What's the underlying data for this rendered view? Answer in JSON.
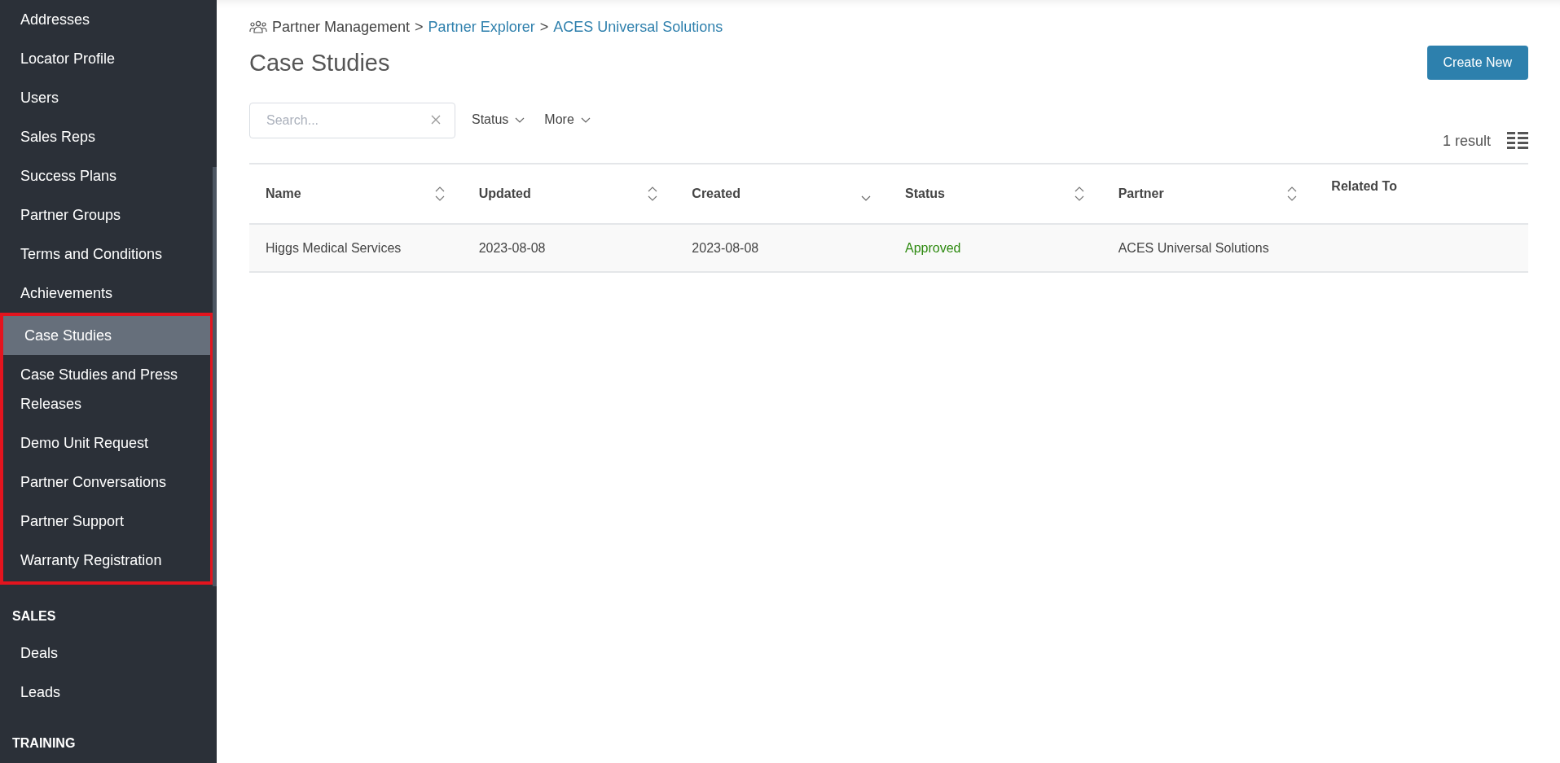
{
  "sidebar": {
    "items": [
      {
        "label": "Addresses",
        "selected": false
      },
      {
        "label": "Locator Profile",
        "selected": false
      },
      {
        "label": "Users",
        "selected": false
      },
      {
        "label": "Sales Reps",
        "selected": false
      },
      {
        "label": "Success Plans",
        "selected": false
      },
      {
        "label": "Partner Groups",
        "selected": false
      },
      {
        "label": "Terms and Conditions",
        "selected": false
      },
      {
        "label": "Achievements",
        "selected": false
      }
    ],
    "highlighted_items": [
      {
        "label": "Case Studies",
        "selected": true
      },
      {
        "label": "Case Studies and Press Releases",
        "selected": false
      },
      {
        "label": "Demo Unit Request",
        "selected": false
      },
      {
        "label": "Partner Conversations",
        "selected": false
      },
      {
        "label": "Partner Support",
        "selected": false
      },
      {
        "label": "Warranty Registration",
        "selected": false
      }
    ],
    "sections": [
      {
        "heading": "SALES",
        "items": [
          {
            "label": "Deals",
            "selected": false
          },
          {
            "label": "Leads",
            "selected": false
          }
        ]
      },
      {
        "heading": "TRAINING"
      }
    ]
  },
  "breadcrumb": [
    {
      "label": "Partner Management",
      "kind": "root"
    },
    {
      "separator": ">",
      "label": "Partner Explorer",
      "kind": "link"
    },
    {
      "separator": ">",
      "label": "ACES Universal Solutions",
      "kind": "link"
    }
  ],
  "page_title": "Case Studies",
  "create_button": "Create New",
  "search": {
    "placeholder": "Search..."
  },
  "filters": [
    "Status",
    "More"
  ],
  "result_count": "1 result",
  "table": {
    "columns": [
      {
        "label": "Name",
        "sortable": true,
        "sorted_desc": false
      },
      {
        "label": "Updated",
        "sortable": true,
        "sorted_desc": false
      },
      {
        "label": "Created",
        "sortable": true,
        "sorted_desc": true
      },
      {
        "label": "Status",
        "sortable": true,
        "sorted_desc": false
      },
      {
        "label": "Partner",
        "sortable": true,
        "sorted_desc": false
      },
      {
        "label": "Related To",
        "sortable": false
      }
    ],
    "rows": [
      {
        "cells": [
          {
            "text": "Higgs Medical Services",
            "kind": "plain"
          },
          {
            "text": "2023-08-08",
            "kind": "plain"
          },
          {
            "text": "2023-08-08",
            "kind": "plain"
          },
          {
            "text": "Approved",
            "kind": "status"
          },
          {
            "text": "ACES Universal Solutions",
            "kind": "plain"
          }
        ]
      }
    ]
  }
}
